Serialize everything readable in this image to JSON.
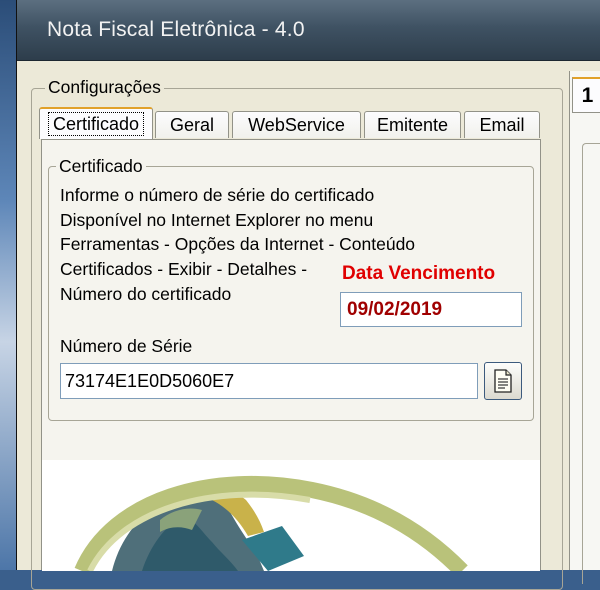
{
  "window": {
    "title": "Nota Fiscal Eletrônica - 4.0"
  },
  "config": {
    "legend": "Configurações",
    "tabs": [
      "Certificado",
      "Geral",
      "WebService",
      "Emitente",
      "Email"
    ]
  },
  "certificado": {
    "legend": "Certificado",
    "lines": [
      "Informe o número de série do certificado",
      "Disponível no Internet Explorer no menu",
      "Ferramentas - Opções da Internet - Conteúdo",
      "Certificados - Exibir - Detalhes -",
      "Número do certificado"
    ],
    "vencimento_label": "Data Vencimento",
    "vencimento_value": "09/02/2019",
    "serie_label": "Número de Série",
    "serie_value": "73174E1E0D5060E7",
    "button_icon": "certificate-document-icon"
  },
  "right_panel": {
    "tab_label": "1"
  },
  "colors": {
    "vencimento": "#e00000",
    "vencimento_value": "#a00000",
    "active_tab_accent": "#e1a12a"
  }
}
